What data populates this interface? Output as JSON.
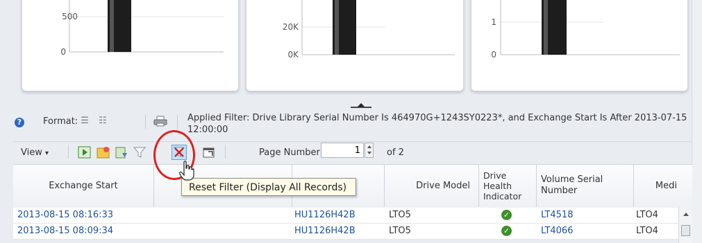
{
  "charts": {
    "chart1": {
      "ticks": [
        "500",
        "0"
      ]
    },
    "chart2": {
      "ticks": [
        "20K",
        "0K"
      ]
    },
    "chart3": {
      "ticks": [
        "1",
        "0"
      ]
    }
  },
  "toolbar": {
    "format_label": "Format:",
    "applied_filter": "Applied Filter: Drive Library Serial Number Is 464970G+1243SY0223*, and Exchange Start Is After 2013-07-15 12:00:00",
    "view_label": "View",
    "page_label": "Page Number:",
    "page_value": "1",
    "page_of": "of 2"
  },
  "tooltip": "Reset Filter (Display All Records)",
  "table": {
    "headers": {
      "exchange_start": "Exchange Start",
      "drive_model": "Drive Model",
      "drive_health": "Drive Health Indicator",
      "volume_serial": "Volume Serial Number",
      "media": "Medi"
    },
    "rows": [
      {
        "exchange_start": "2013-08-15 08:16:33",
        "drive_serial": "HU1126H42B",
        "drive_model": "LTO5",
        "volume_serial": "LT4518",
        "media": "LTO4"
      },
      {
        "exchange_start": "2013-08-15 08:09:34",
        "drive_serial": "HU1126H42B",
        "drive_model": "LTO5",
        "volume_serial": "LT4066",
        "media": "LTO4"
      }
    ]
  },
  "colors": {
    "link": "#1d4f9c",
    "highlight_circle": "#e01f1f",
    "health_ok": "#3f8f2b"
  }
}
